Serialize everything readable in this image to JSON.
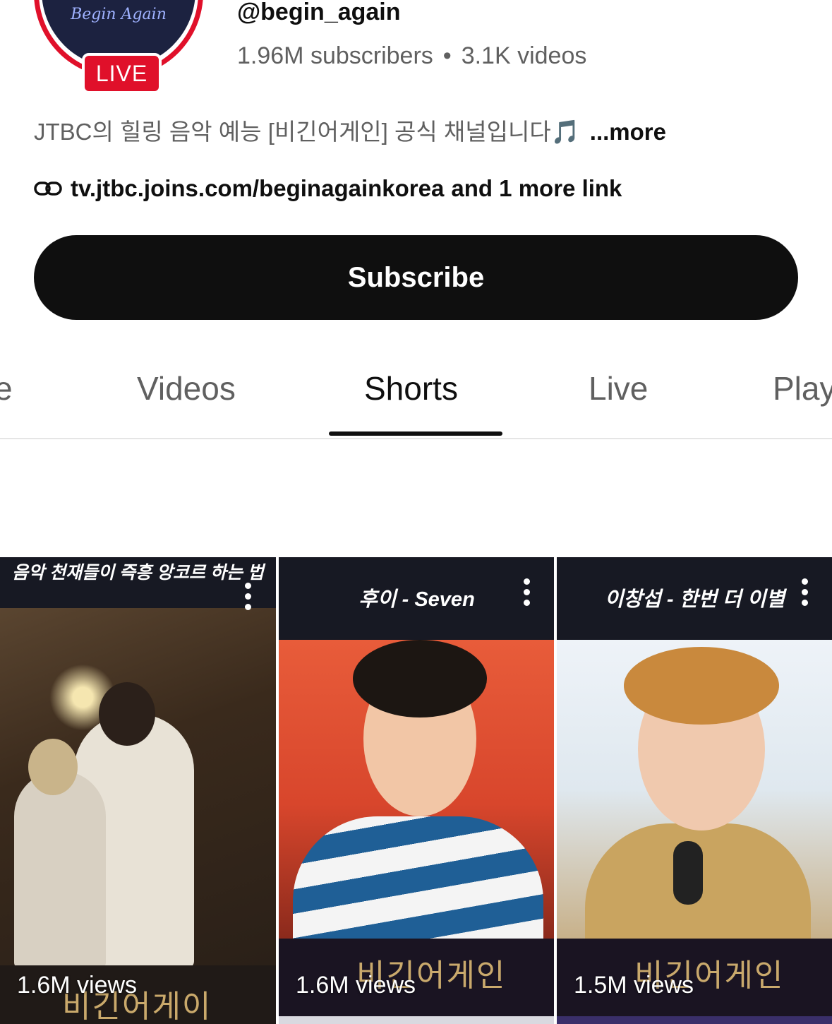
{
  "channel": {
    "avatar_script": "Begin Again",
    "live_badge": "LIVE",
    "handle": "@begin_again",
    "subscribers": "1.96M subscribers",
    "stats_separator": "•",
    "videos": "3.1K videos",
    "description": "JTBC의 힐링 음악 예능 [비긴어게인] 공식 채널입니다🎵",
    "more_label": "...more",
    "link_url": "tv.jtbc.joins.com/beginagainkorea",
    "link_more": "and 1 more link"
  },
  "subscribe_label": "Subscribe",
  "tabs": [
    {
      "label": "e",
      "active": false
    },
    {
      "label": "Videos",
      "active": false
    },
    {
      "label": "Shorts",
      "active": true
    },
    {
      "label": "Live",
      "active": false
    },
    {
      "label": "Play",
      "active": false
    }
  ],
  "shorts": [
    {
      "title": "음악 천재들이 즉흥 앙코르 하는 법",
      "views": "1.6M views",
      "logo": "비긴어게이"
    },
    {
      "title": "후이 - Seven",
      "views": "1.6M views",
      "logo": "비긴어게인"
    },
    {
      "title": "이창섭 - 한번 더 이별",
      "views": "1.5M views",
      "logo": "비긴어게인"
    }
  ],
  "colors": {
    "live_red": "#e0102a",
    "button_black": "#0f0f0f",
    "secondary_text": "#606060"
  }
}
